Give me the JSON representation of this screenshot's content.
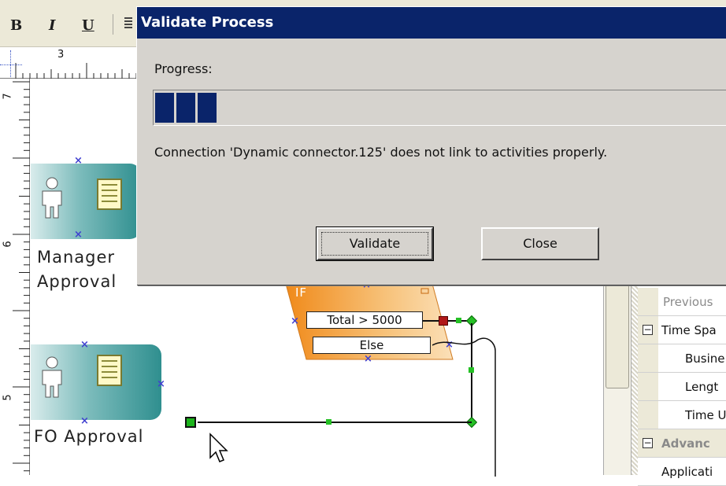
{
  "toolbar": {
    "bold": "B",
    "italic": "I",
    "underline": "U"
  },
  "ruler": {
    "top_label": "3",
    "left_labels": [
      "7",
      "6",
      "5"
    ]
  },
  "canvas": {
    "manager_label": [
      "Manager",
      "Approval"
    ],
    "cfo_label": "FO Approval",
    "if_label": "IF",
    "condition_1": "Total > 5000",
    "condition_2": "Else",
    "marker_glyph": "×"
  },
  "properties": {
    "rows": [
      {
        "label": "Previous",
        "indent": true,
        "expander": false,
        "bold": false,
        "muted": true
      },
      {
        "label": "Time Spa",
        "indent": false,
        "expander": true,
        "bold": false,
        "muted": false
      },
      {
        "label": "Busine",
        "indent": true,
        "expander": false,
        "bold": false,
        "muted": false
      },
      {
        "label": "Lengt",
        "indent": true,
        "expander": false,
        "bold": false,
        "muted": false
      },
      {
        "label": "Time U",
        "indent": true,
        "expander": false,
        "bold": false,
        "muted": false
      },
      {
        "label": "Advanc",
        "indent": false,
        "expander": true,
        "bold": true,
        "muted": true
      },
      {
        "label": "Applicati",
        "indent": false,
        "expander": false,
        "bold": false,
        "muted": false
      }
    ],
    "expander_glyph": "−"
  },
  "dialog": {
    "title": "Validate Process",
    "progress_label": "Progress:",
    "progress_blocks": 3,
    "message": "Connection 'Dynamic connector.125' does not link to activities properly.",
    "validate_label": "Validate",
    "close_label": "Close"
  },
  "colors": {
    "title_bar": "#0a246a",
    "dialog_bg": "#d6d3ce",
    "connector_point": "#25c025",
    "if_shape": "#f4a64a"
  },
  "icons": [
    "bold-icon",
    "italic-icon",
    "underline-icon",
    "align-icon",
    "person-icon",
    "document-icon",
    "mouse-pointer-icon"
  ]
}
